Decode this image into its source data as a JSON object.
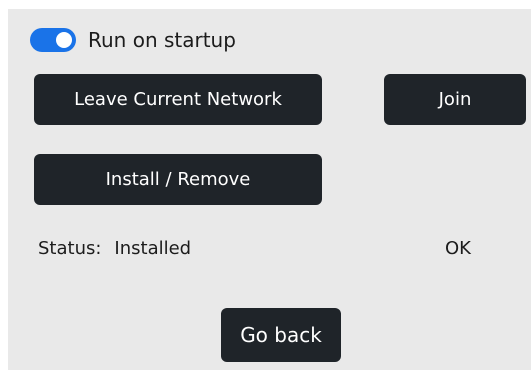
{
  "startup": {
    "label": "Run on startup",
    "enabled": true
  },
  "buttons": {
    "leave": "Leave Current Network",
    "join": "Join",
    "install": "Install / Remove",
    "go_back": "Go back"
  },
  "status": {
    "label": "Status:",
    "value": "Installed",
    "ok": "OK"
  },
  "colors": {
    "accent": "#1a73e8",
    "button_bg": "#1f2429",
    "panel_bg": "#e9e9e9"
  }
}
